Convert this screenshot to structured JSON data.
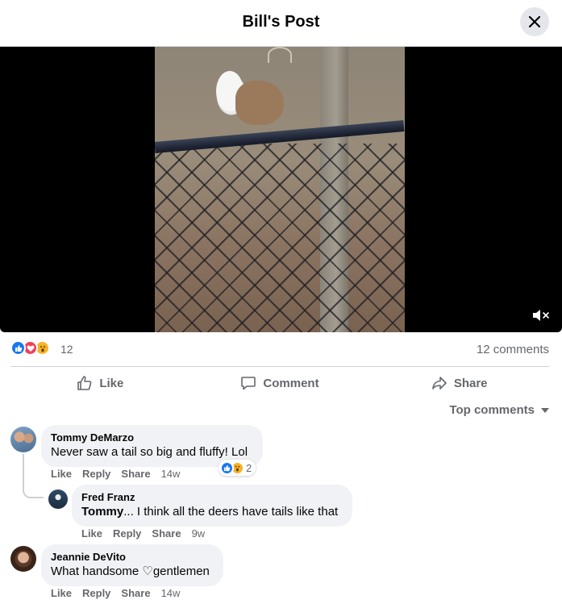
{
  "header": {
    "title": "Bill's Post"
  },
  "icons": {
    "close": "close-icon",
    "mute": "volume-muted-icon",
    "like": "thumbs-up-icon",
    "comment": "comment-bubble-icon",
    "share": "share-arrow-icon",
    "sort": "caret-down-icon"
  },
  "colors": {
    "like_blue": "#1877f2",
    "love_red": "#f33e58",
    "wow_yellow": "#f7b125",
    "secondary_text": "#65676b",
    "bubble_bg": "#f0f2f5"
  },
  "stats": {
    "reaction_count": "12",
    "comments_label": "12 comments"
  },
  "actions": {
    "like": "Like",
    "comment": "Comment",
    "share": "Share"
  },
  "sort": {
    "label": "Top comments"
  },
  "comments": [
    {
      "name": "Tommy DeMarzo",
      "text": "Never saw a tail so big and fluffy! Lol",
      "like": "Like",
      "reply": "Reply",
      "share": "Share",
      "time": "14w",
      "reaction_count": "2"
    },
    {
      "name": "Fred Franz",
      "mention": "Tommy",
      "text": "... I think all the deers have tails like that",
      "like": "Like",
      "reply": "Reply",
      "share": "Share",
      "time": "9w"
    },
    {
      "name": "Jeannie DeVito",
      "text": "What handsome ♡gentlemen",
      "like": "Like",
      "reply": "Reply",
      "share": "Share",
      "time": "14w"
    }
  ]
}
